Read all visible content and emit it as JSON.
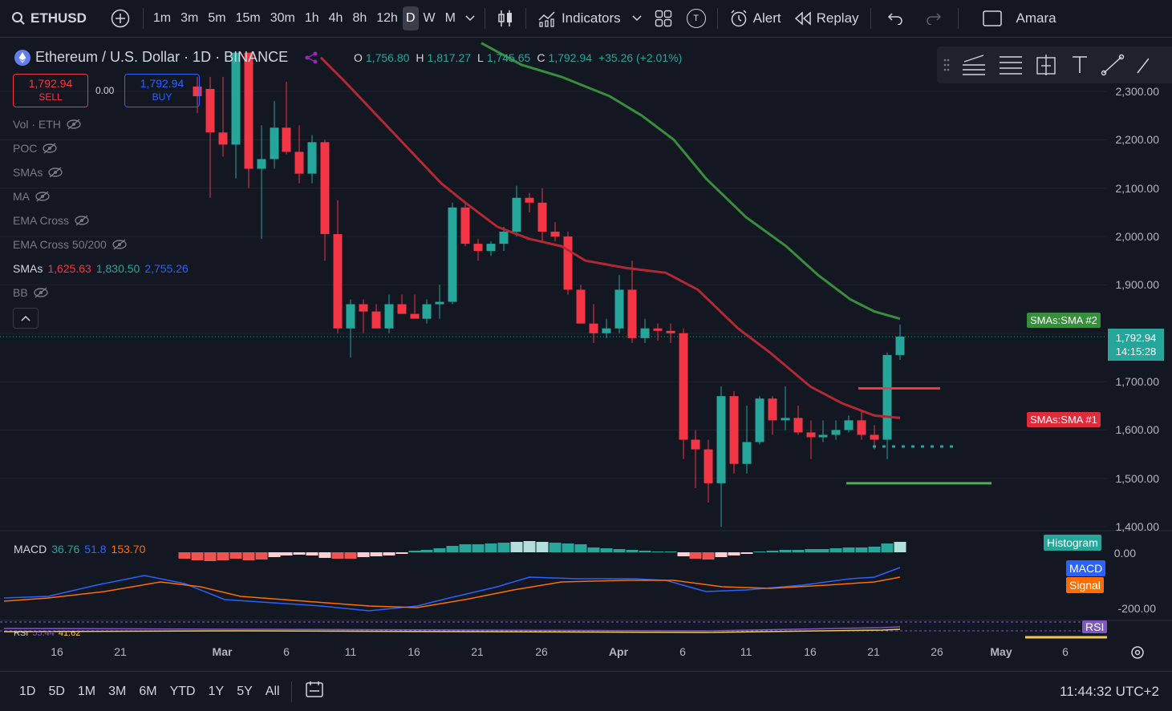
{
  "topbar": {
    "symbol": "ETHUSD",
    "timeframes": [
      "1m",
      "3m",
      "5m",
      "15m",
      "30m",
      "1h",
      "4h",
      "8h",
      "12h",
      "D",
      "W",
      "M"
    ],
    "active_timeframe": "D",
    "indicators_label": "Indicators",
    "template_badge": "T",
    "alert_label": "Alert",
    "replay_label": "Replay",
    "user_label": "Amara"
  },
  "header": {
    "title": "Ethereum / U.S. Dollar · 1D · BINANCE",
    "ohlc": {
      "o": "1,756.80",
      "h": "1,817.27",
      "l": "1,745.65",
      "c": "1,792.94",
      "chg": "+35.26 (+2.01%)"
    },
    "o_label": "O",
    "h_label": "H",
    "l_label": "L",
    "c_label": "C"
  },
  "trade": {
    "sell_price": "1,792.94",
    "sell_label": "SELL",
    "spread": "0.00",
    "buy_price": "1,792.94",
    "buy_label": "BUY"
  },
  "legend": {
    "items": [
      "Vol · ETH",
      "POC",
      "SMAs",
      "MA",
      "EMA Cross",
      "EMA Cross 50/200"
    ],
    "smas_label": "SMAs",
    "smas_values": [
      "1,625.63",
      "1,830.50",
      "2,755.26"
    ],
    "bb_label": "BB",
    "collapse_icon": "chevron-up-icon"
  },
  "price_axis": {
    "labels": [
      "2,300.00",
      "2,200.00",
      "2,100.00",
      "2,000.00",
      "1,900.00",
      "1,700.00",
      "1,600.00",
      "1,500.00",
      "1,400.00"
    ],
    "current_price": "1,792.94",
    "countdown": "14:15:28",
    "sma2_tag": "SMAs:SMA #2",
    "sma1_tag": "SMAs:SMA #1"
  },
  "macd": {
    "label": "MACD",
    "values": [
      "36.76",
      "51.8",
      "153.70"
    ],
    "histogram_tag": "Histogram",
    "macd_tag": "MACD",
    "signal_tag": "Signal",
    "axis": [
      "0.00",
      "-200.00"
    ]
  },
  "rsi": {
    "tag": "RSI",
    "label": "RSI",
    "values": [
      "55.44",
      "41.62"
    ]
  },
  "time_axis": {
    "labels": [
      "16",
      "21",
      "Mar",
      "6",
      "11",
      "16",
      "21",
      "26",
      "Apr",
      "6",
      "11",
      "16",
      "21",
      "26",
      "May",
      "6"
    ]
  },
  "bottombar": {
    "ranges": [
      "1D",
      "5D",
      "1M",
      "3M",
      "6M",
      "YTD",
      "1Y",
      "5Y",
      "All"
    ],
    "clock": "11:44:32 UTC+2"
  },
  "colors": {
    "up": "#26a69a",
    "down": "#f23645",
    "sma_red": "#b22833",
    "sma_green": "#388e3c",
    "macd_line": "#2962ff",
    "signal_line": "#ff6d00",
    "bg": "#131722"
  }
}
